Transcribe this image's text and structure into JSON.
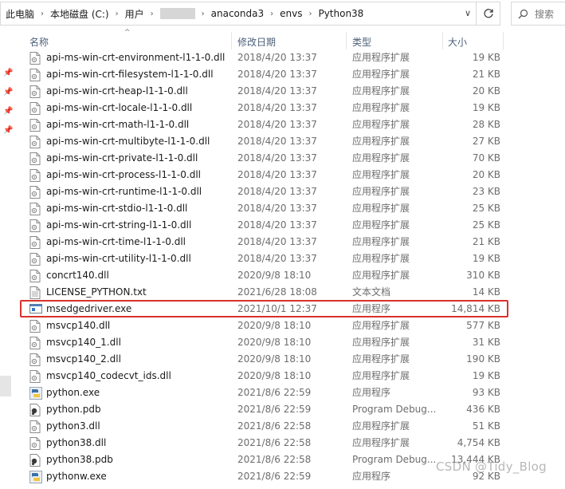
{
  "breadcrumb": {
    "items": [
      "此电脑",
      "本地磁盘 (C:)",
      "用户",
      "anaconda3",
      "envs",
      "Python38"
    ]
  },
  "search": {
    "placeholder": "搜索"
  },
  "columns": {
    "name": "名称",
    "date": "修改日期",
    "type": "类型",
    "size": "大小"
  },
  "files": [
    {
      "name": "api-ms-win-crt-environment-l1-1-0.dll",
      "date": "2018/4/20 13:37",
      "type": "应用程序扩展",
      "size": "19 KB",
      "icon": "dll"
    },
    {
      "name": "api-ms-win-crt-filesystem-l1-1-0.dll",
      "date": "2018/4/20 13:37",
      "type": "应用程序扩展",
      "size": "21 KB",
      "icon": "dll"
    },
    {
      "name": "api-ms-win-crt-heap-l1-1-0.dll",
      "date": "2018/4/20 13:37",
      "type": "应用程序扩展",
      "size": "20 KB",
      "icon": "dll"
    },
    {
      "name": "api-ms-win-crt-locale-l1-1-0.dll",
      "date": "2018/4/20 13:37",
      "type": "应用程序扩展",
      "size": "19 KB",
      "icon": "dll"
    },
    {
      "name": "api-ms-win-crt-math-l1-1-0.dll",
      "date": "2018/4/20 13:37",
      "type": "应用程序扩展",
      "size": "28 KB",
      "icon": "dll"
    },
    {
      "name": "api-ms-win-crt-multibyte-l1-1-0.dll",
      "date": "2018/4/20 13:37",
      "type": "应用程序扩展",
      "size": "27 KB",
      "icon": "dll"
    },
    {
      "name": "api-ms-win-crt-private-l1-1-0.dll",
      "date": "2018/4/20 13:37",
      "type": "应用程序扩展",
      "size": "70 KB",
      "icon": "dll"
    },
    {
      "name": "api-ms-win-crt-process-l1-1-0.dll",
      "date": "2018/4/20 13:37",
      "type": "应用程序扩展",
      "size": "20 KB",
      "icon": "dll"
    },
    {
      "name": "api-ms-win-crt-runtime-l1-1-0.dll",
      "date": "2018/4/20 13:37",
      "type": "应用程序扩展",
      "size": "23 KB",
      "icon": "dll"
    },
    {
      "name": "api-ms-win-crt-stdio-l1-1-0.dll",
      "date": "2018/4/20 13:37",
      "type": "应用程序扩展",
      "size": "25 KB",
      "icon": "dll"
    },
    {
      "name": "api-ms-win-crt-string-l1-1-0.dll",
      "date": "2018/4/20 13:37",
      "type": "应用程序扩展",
      "size": "25 KB",
      "icon": "dll"
    },
    {
      "name": "api-ms-win-crt-time-l1-1-0.dll",
      "date": "2018/4/20 13:37",
      "type": "应用程序扩展",
      "size": "21 KB",
      "icon": "dll"
    },
    {
      "name": "api-ms-win-crt-utility-l1-1-0.dll",
      "date": "2018/4/20 13:37",
      "type": "应用程序扩展",
      "size": "19 KB",
      "icon": "dll"
    },
    {
      "name": "concrt140.dll",
      "date": "2020/9/8 18:10",
      "type": "应用程序扩展",
      "size": "310 KB",
      "icon": "dll"
    },
    {
      "name": "LICENSE_PYTHON.txt",
      "date": "2021/6/28 18:08",
      "type": "文本文档",
      "size": "14 KB",
      "icon": "txt"
    },
    {
      "name": "msedgedriver.exe",
      "date": "2021/10/1 12:37",
      "type": "应用程序",
      "size": "14,814 KB",
      "icon": "exe"
    },
    {
      "name": "msvcp140.dll",
      "date": "2020/9/8 18:10",
      "type": "应用程序扩展",
      "size": "577 KB",
      "icon": "dll"
    },
    {
      "name": "msvcp140_1.dll",
      "date": "2020/9/8 18:10",
      "type": "应用程序扩展",
      "size": "31 KB",
      "icon": "dll"
    },
    {
      "name": "msvcp140_2.dll",
      "date": "2020/9/8 18:10",
      "type": "应用程序扩展",
      "size": "190 KB",
      "icon": "dll"
    },
    {
      "name": "msvcp140_codecvt_ids.dll",
      "date": "2020/9/8 18:10",
      "type": "应用程序扩展",
      "size": "19 KB",
      "icon": "dll"
    },
    {
      "name": "python.exe",
      "date": "2021/8/6 22:59",
      "type": "应用程序",
      "size": "93 KB",
      "icon": "python"
    },
    {
      "name": "python.pdb",
      "date": "2021/8/6 22:59",
      "type": "Program Debug...",
      "size": "436 KB",
      "icon": "pdb"
    },
    {
      "name": "python3.dll",
      "date": "2021/8/6 22:58",
      "type": "应用程序扩展",
      "size": "51 KB",
      "icon": "dll"
    },
    {
      "name": "python38.dll",
      "date": "2021/8/6 22:58",
      "type": "应用程序扩展",
      "size": "4,754 KB",
      "icon": "dll"
    },
    {
      "name": "python38.pdb",
      "date": "2021/8/6 22:58",
      "type": "Program Debug...",
      "size": "13,444 KB",
      "icon": "pdb"
    },
    {
      "name": "pythonw.exe",
      "date": "2021/8/6 22:59",
      "type": "应用程序",
      "size": "92 KB",
      "icon": "python"
    }
  ],
  "watermark": "CSDN @Tidy_Blog",
  "colors": {
    "highlight": "#d9322c",
    "header_text": "#4c607a"
  }
}
